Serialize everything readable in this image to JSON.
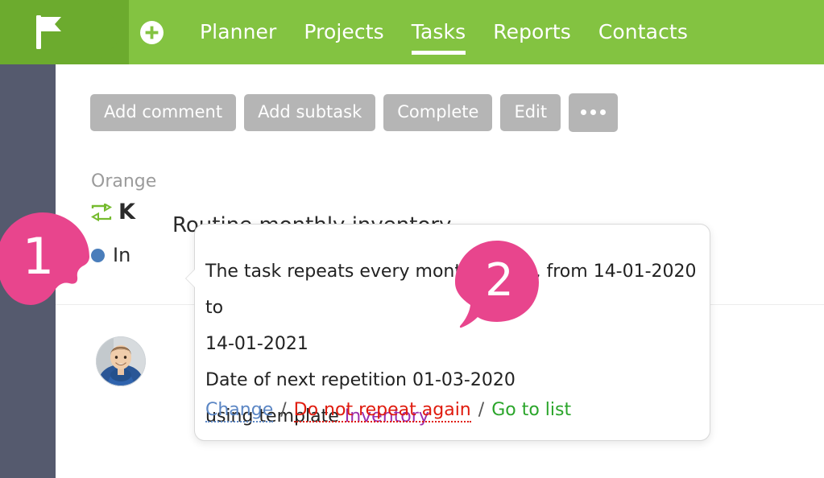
{
  "header": {
    "logo_icon": "flag-logo-icon",
    "add_icon": "plus-circle-icon",
    "nav": [
      {
        "label": "Planner",
        "active": false
      },
      {
        "label": "Projects",
        "active": false
      },
      {
        "label": "Tasks",
        "active": true
      },
      {
        "label": "Reports",
        "active": false
      },
      {
        "label": "Contacts",
        "active": false
      }
    ],
    "accent_green": "#83c341",
    "accent_green_dark": "#6cab2e"
  },
  "toolbar": {
    "buttons": [
      {
        "label": "Add comment",
        "name": "add-comment-button"
      },
      {
        "label": "Add subtask",
        "name": "add-subtask-button"
      },
      {
        "label": "Complete",
        "name": "complete-button"
      },
      {
        "label": "Edit",
        "name": "edit-button"
      }
    ],
    "more_label": "•••",
    "button_color": "#b5b5b5"
  },
  "task": {
    "project": "Orange",
    "title": "K",
    "repeat_icon": "repeat-arrows-icon",
    "status_label": "In",
    "status_color": "#4a7ebb"
  },
  "comment": {
    "avatar": "user-avatar",
    "text": "Routine monthly inventory"
  },
  "popup": {
    "line1": "The task repeats every month 1 date, from 14-01-2020 to",
    "line2": "14-01-2021",
    "line3": "Date of next repetition 01-03-2020",
    "line4_prefix": "using template ",
    "line4_template": "Inventory",
    "template_color": "#9b2fae",
    "actions": {
      "change": "Change",
      "sep1": "/",
      "do_not_repeat": "Do not repeat again",
      "sep2": "/",
      "go_to_list": "Go to list",
      "change_color": "#5b86c4",
      "do_not_repeat_color": "#e01b0e",
      "go_to_list_color": "#2aa52a"
    }
  },
  "callouts": {
    "badge_color": "#e8458d",
    "one": "1",
    "two": "2"
  }
}
